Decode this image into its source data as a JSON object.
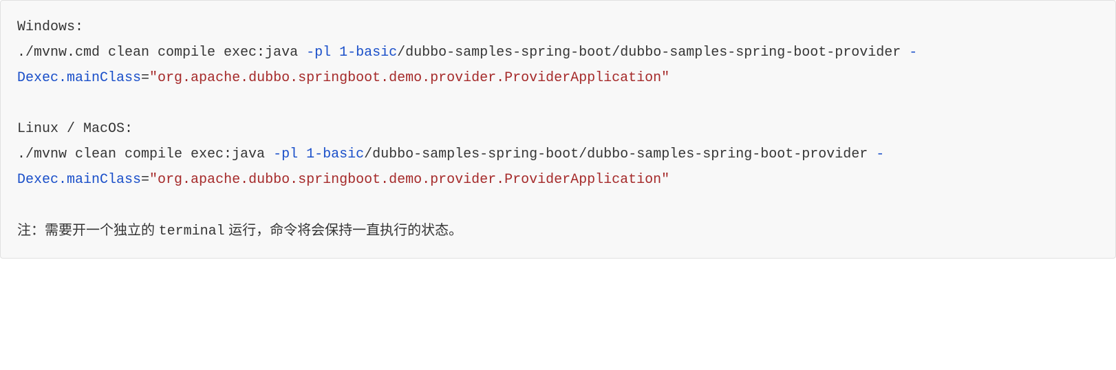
{
  "code": {
    "win_label": "Windows:",
    "win_cmd_prefix": "./mvnw.cmd clean compile exec:java ",
    "pl_flag": "-pl",
    "one": "1",
    "basic": "-basic",
    "path_after_basic": "/dubbo-samples-spring-boot/dubbo-samples-spring-boot-provider ",
    "dash": "-",
    "dexec": "Dexec.mainClass",
    "eq": "=",
    "main_class": "\"org.apache.dubbo.springboot.demo.provider.ProviderApplication\"",
    "linux_label": "Linux / MacOS:",
    "linux_cmd_prefix": "./mvnw clean compile exec:java "
  },
  "note": {
    "p1": "注：需要开一个独立的 ",
    "terminal": "terminal",
    "p2": " 运行，命令将会保持一直执行的状态。"
  }
}
